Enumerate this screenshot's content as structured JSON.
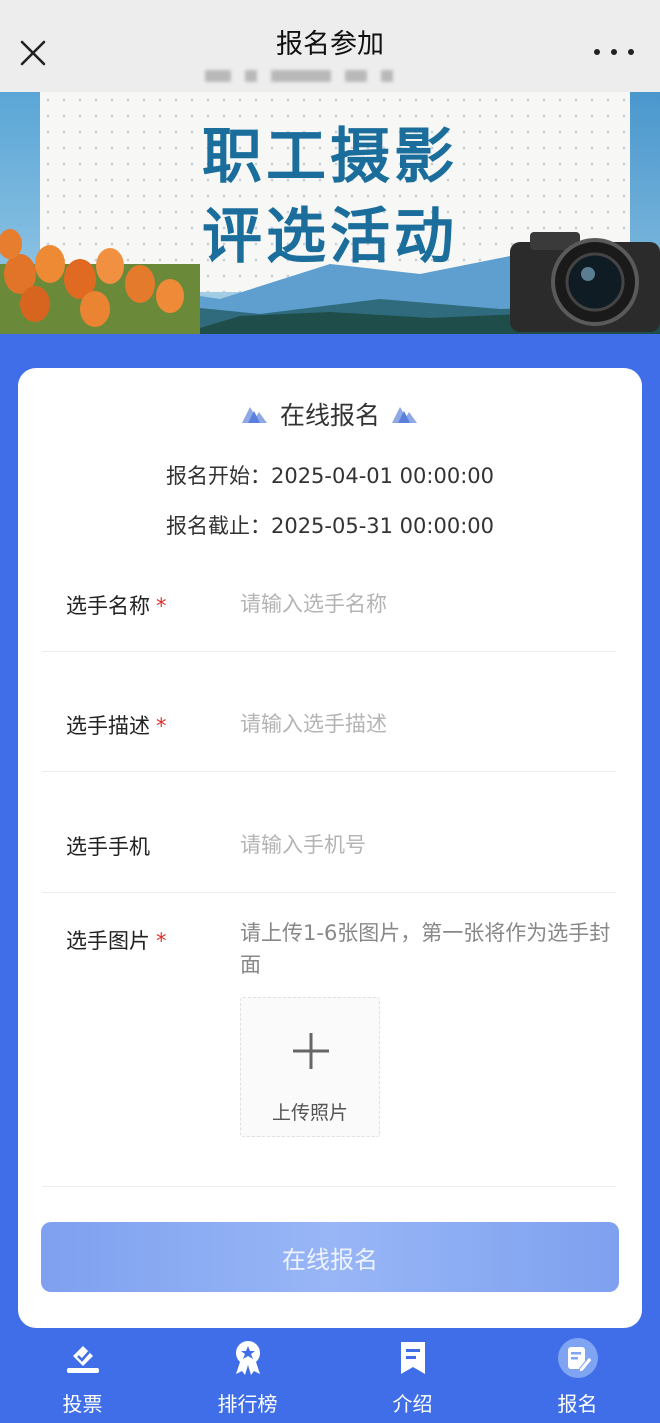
{
  "header": {
    "title": "报名参加"
  },
  "banner": {
    "line1": "职工摄影",
    "line2": "评选活动"
  },
  "form": {
    "heading": "在线报名",
    "start_text": "报名开始：2025-04-01 00:00:00",
    "end_text": "报名截止：2025-05-31 00:00:00",
    "required_mark": "*",
    "fields": [
      {
        "label": "选手名称",
        "value": "",
        "placeholder": "请输入选手名称",
        "required": true
      },
      {
        "label": "选手描述",
        "value": "",
        "placeholder": "请输入选手描述",
        "required": true
      },
      {
        "label": "选手手机",
        "value": "",
        "placeholder": "请输入手机号",
        "required": false
      },
      {
        "label": "选手图片",
        "hint": "请上传1-6张图片，第一张将作为选手封面",
        "required": true
      }
    ],
    "upload_label": "上传照片",
    "submit_label": "在线报名"
  },
  "bottom_nav": {
    "items": [
      {
        "label": "投票",
        "icon": "vote-icon"
      },
      {
        "label": "排行榜",
        "icon": "award-icon"
      },
      {
        "label": "介绍",
        "icon": "bookmark-icon"
      },
      {
        "label": "报名",
        "icon": "edit-form-icon"
      }
    ]
  },
  "colors": {
    "accent": "#3f6ee8",
    "required": "#e03030",
    "submit_button": "#8aa9f2",
    "banner_title": "#1b6d9b"
  }
}
